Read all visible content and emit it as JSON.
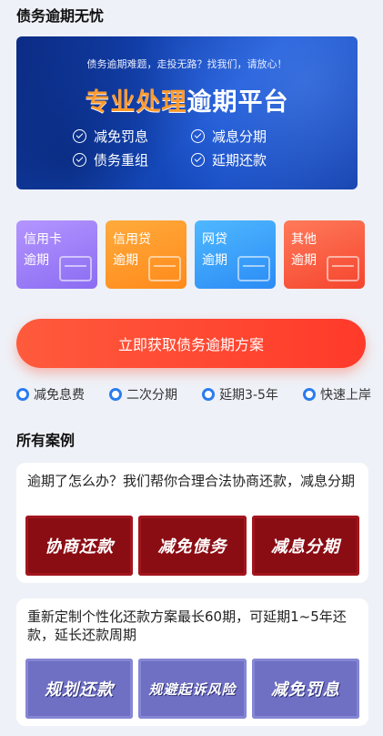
{
  "header": {
    "title": "债务逾期无忧"
  },
  "banner": {
    "tagline": "债务逾期难题，走投无路？找我们，请放心！",
    "headline_a": "专业处理",
    "headline_b": "逾期平台",
    "features": [
      "减免罚息",
      "减息分期",
      "债务重组",
      "延期还款"
    ],
    "dots": 2,
    "active_dot": 0
  },
  "categories": [
    {
      "line1": "信用卡",
      "line2": "逾期",
      "color": "#a17ff7"
    },
    {
      "line1": "信用贷",
      "line2": "逾期",
      "color": "#ff9b27"
    },
    {
      "line1": "网贷",
      "line2": "逾期",
      "color": "#3aa2fb"
    },
    {
      "line1": "其他",
      "line2": "逾期",
      "color": "#f85f40"
    }
  ],
  "cta": {
    "label": "立即获取债务逾期方案"
  },
  "perks": [
    "减免息费",
    "二次分期",
    "延期3-5年",
    "快速上岸"
  ],
  "cases": {
    "title": "所有案例",
    "items": [
      {
        "description": "逾期了怎么办？我们帮你合理合法协商还款，减息分期",
        "tags": [
          "协商还款",
          "减免债务",
          "减息分期"
        ]
      },
      {
        "description": "重新定制个性化还款方案最长60期，可延期1~5年还款，延长还款周期",
        "tags": [
          "规划还款",
          "规避起诉风险",
          "减免罚息"
        ]
      }
    ]
  }
}
